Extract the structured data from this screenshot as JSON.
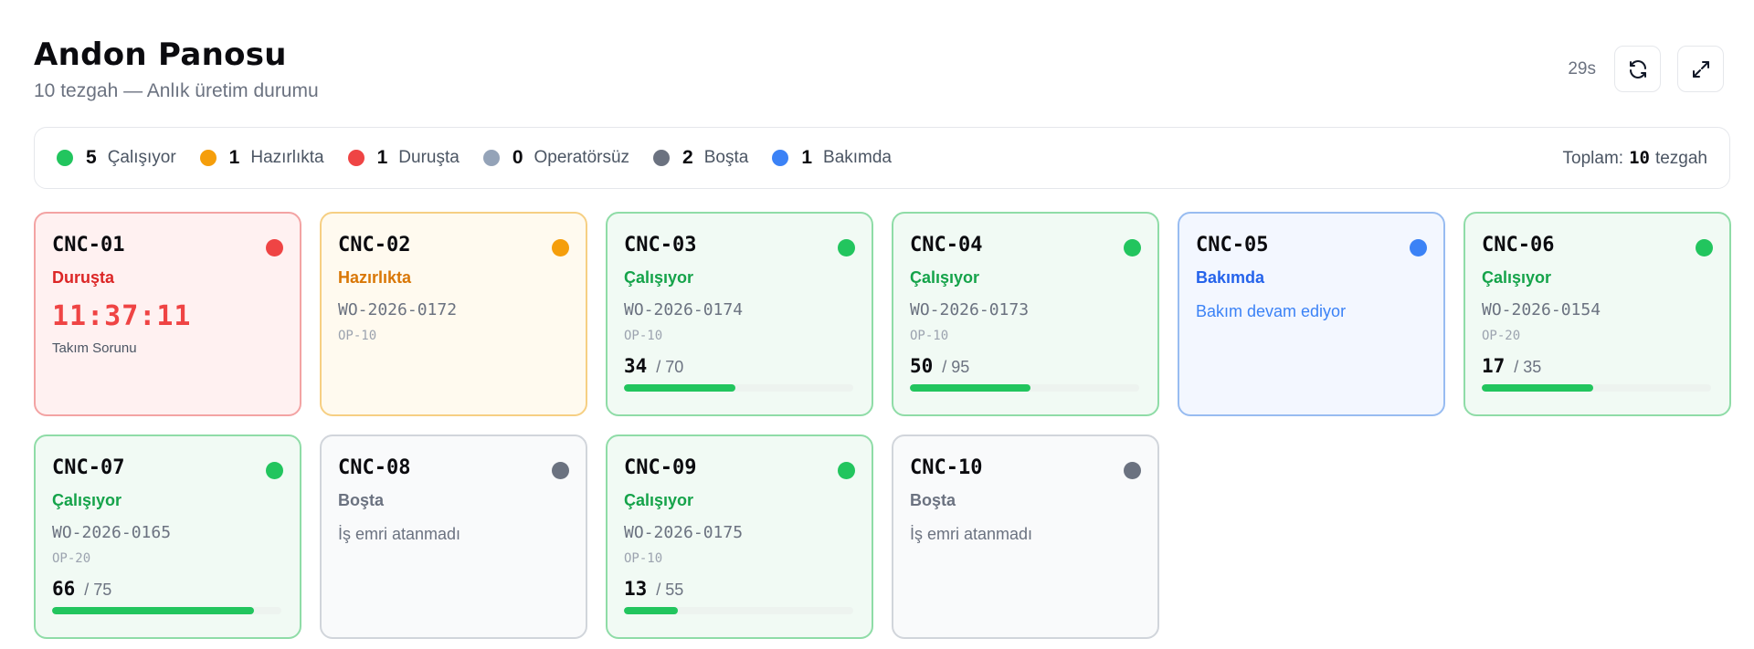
{
  "header": {
    "title": "Andon Panosu",
    "subtitle": "10 tezgah — Anlık üretim durumu",
    "refresh_timer": "29s",
    "refresh_icon": "refresh-icon",
    "expand_icon": "fullscreen-icon"
  },
  "legend": {
    "items": [
      {
        "count": "5",
        "label": "Çalışıyor",
        "color": "#22c55e"
      },
      {
        "count": "1",
        "label": "Hazırlıkta",
        "color": "#f59e0b"
      },
      {
        "count": "1",
        "label": "Duruşta",
        "color": "#ef4444"
      },
      {
        "count": "0",
        "label": "Operatörsüz",
        "color": "#94a3b8"
      },
      {
        "count": "2",
        "label": "Boşta",
        "color": "#6b7280"
      },
      {
        "count": "1",
        "label": "Bakımda",
        "color": "#3b82f6"
      }
    ],
    "total_prefix": "Toplam:",
    "total_count": "10",
    "total_suffix": "tezgah"
  },
  "machines": [
    {
      "name": "CNC-01",
      "state": "down",
      "status": "Duruşta",
      "dot": "#ef4444",
      "timer": "11:37:11",
      "reason": "Takım Sorunu"
    },
    {
      "name": "CNC-02",
      "state": "setup",
      "status": "Hazırlıkta",
      "dot": "#f59e0b",
      "wo": "WO-2026-0172",
      "op": "OP-10"
    },
    {
      "name": "CNC-03",
      "state": "running",
      "status": "Çalışıyor",
      "dot": "#22c55e",
      "wo": "WO-2026-0174",
      "op": "OP-10",
      "done": "34",
      "target": "/ 70",
      "progress": 0.486
    },
    {
      "name": "CNC-04",
      "state": "running",
      "status": "Çalışıyor",
      "dot": "#22c55e",
      "wo": "WO-2026-0173",
      "op": "OP-10",
      "done": "50",
      "target": "/ 95",
      "progress": 0.526
    },
    {
      "name": "CNC-05",
      "state": "maint",
      "status": "Bakımda",
      "dot": "#3b82f6",
      "note": "Bakım devam ediyor"
    },
    {
      "name": "CNC-06",
      "state": "running",
      "status": "Çalışıyor",
      "dot": "#22c55e",
      "wo": "WO-2026-0154",
      "op": "OP-20",
      "done": "17",
      "target": "/ 35",
      "progress": 0.486
    },
    {
      "name": "CNC-07",
      "state": "running",
      "status": "Çalışıyor",
      "dot": "#22c55e",
      "wo": "WO-2026-0165",
      "op": "OP-20",
      "done": "66",
      "target": "/ 75",
      "progress": 0.88
    },
    {
      "name": "CNC-08",
      "state": "idle",
      "status": "Boşta",
      "dot": "#6b7280",
      "note": "İş emri atanmadı"
    },
    {
      "name": "CNC-09",
      "state": "running",
      "status": "Çalışıyor",
      "dot": "#22c55e",
      "wo": "WO-2026-0175",
      "op": "OP-10",
      "done": "13",
      "target": "/ 55",
      "progress": 0.236
    },
    {
      "name": "CNC-10",
      "state": "idle",
      "status": "Boşta",
      "dot": "#6b7280",
      "note": "İş emri atanmadı"
    }
  ]
}
